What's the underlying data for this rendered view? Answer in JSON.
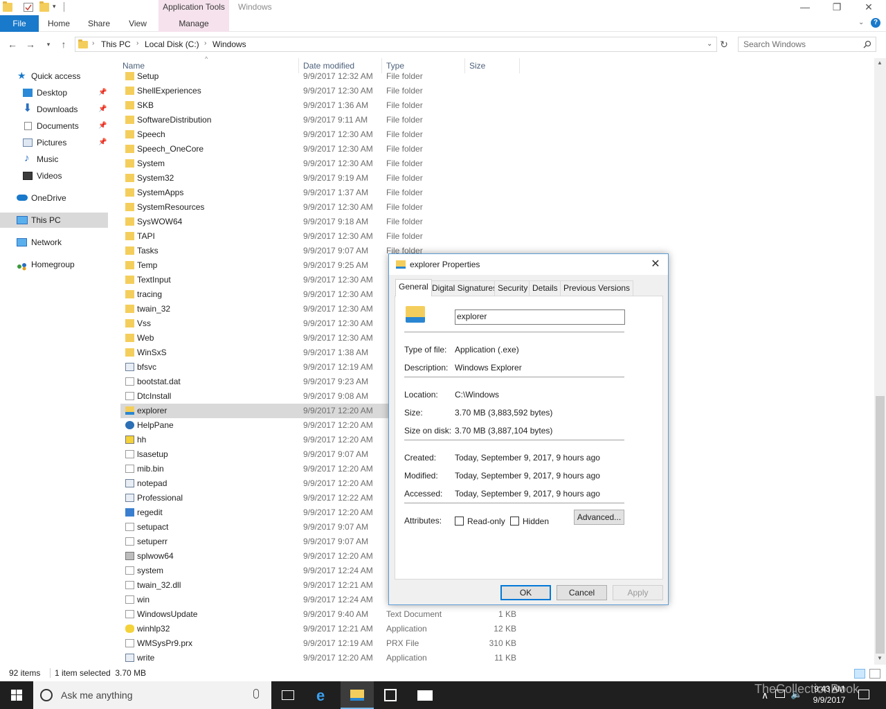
{
  "window": {
    "contextual_tab_group": "Application Tools",
    "title": "Windows",
    "minimize": "—",
    "maximize": "❐",
    "close": "✕"
  },
  "ribbon": {
    "file": "File",
    "tabs": [
      "Home",
      "Share",
      "View",
      "Manage"
    ]
  },
  "address": {
    "crumbs": [
      "This PC",
      "Local Disk (C:)",
      "Windows"
    ],
    "search_placeholder": "Search Windows"
  },
  "navpane": {
    "items": [
      {
        "label": "Quick access",
        "icon": "star-icon"
      },
      {
        "label": "Desktop",
        "icon": "desktop-icon",
        "pinned": true
      },
      {
        "label": "Downloads",
        "icon": "download-icon",
        "pinned": true
      },
      {
        "label": "Documents",
        "icon": "documents-icon",
        "pinned": true
      },
      {
        "label": "Pictures",
        "icon": "pictures-icon",
        "pinned": true
      },
      {
        "label": "Music",
        "icon": "music-icon"
      },
      {
        "label": "Videos",
        "icon": "videos-icon"
      },
      {
        "label": "OneDrive",
        "icon": "onedrive-icon"
      },
      {
        "label": "This PC",
        "icon": "computer-icon",
        "selected": true
      },
      {
        "label": "Network",
        "icon": "network-icon"
      },
      {
        "label": "Homegroup",
        "icon": "homegroup-icon"
      }
    ]
  },
  "columns": {
    "name": "Name",
    "date": "Date modified",
    "type": "Type",
    "size": "Size"
  },
  "files": [
    {
      "name": "Setup",
      "date": "9/9/2017 12:32 AM",
      "type": "File folder",
      "size": "",
      "icon": "folder"
    },
    {
      "name": "ShellExperiences",
      "date": "9/9/2017 12:30 AM",
      "type": "File folder",
      "size": "",
      "icon": "folder"
    },
    {
      "name": "SKB",
      "date": "9/9/2017 1:36 AM",
      "type": "File folder",
      "size": "",
      "icon": "folder"
    },
    {
      "name": "SoftwareDistribution",
      "date": "9/9/2017 9:11 AM",
      "type": "File folder",
      "size": "",
      "icon": "folder"
    },
    {
      "name": "Speech",
      "date": "9/9/2017 12:30 AM",
      "type": "File folder",
      "size": "",
      "icon": "folder"
    },
    {
      "name": "Speech_OneCore",
      "date": "9/9/2017 12:30 AM",
      "type": "File folder",
      "size": "",
      "icon": "folder"
    },
    {
      "name": "System",
      "date": "9/9/2017 12:30 AM",
      "type": "File folder",
      "size": "",
      "icon": "folder"
    },
    {
      "name": "System32",
      "date": "9/9/2017 9:19 AM",
      "type": "File folder",
      "size": "",
      "icon": "folder"
    },
    {
      "name": "SystemApps",
      "date": "9/9/2017 1:37 AM",
      "type": "File folder",
      "size": "",
      "icon": "folder"
    },
    {
      "name": "SystemResources",
      "date": "9/9/2017 12:30 AM",
      "type": "File folder",
      "size": "",
      "icon": "folder"
    },
    {
      "name": "SysWOW64",
      "date": "9/9/2017 9:18 AM",
      "type": "File folder",
      "size": "",
      "icon": "folder"
    },
    {
      "name": "TAPI",
      "date": "9/9/2017 12:30 AM",
      "type": "File folder",
      "size": "",
      "icon": "folder"
    },
    {
      "name": "Tasks",
      "date": "9/9/2017 9:07 AM",
      "type": "File folder",
      "size": "",
      "icon": "folder"
    },
    {
      "name": "Temp",
      "date": "9/9/2017 9:25 AM",
      "type": "",
      "size": "",
      "icon": "folder"
    },
    {
      "name": "TextInput",
      "date": "9/9/2017 12:30 AM",
      "type": "",
      "size": "",
      "icon": "folder"
    },
    {
      "name": "tracing",
      "date": "9/9/2017 12:30 AM",
      "type": "",
      "size": "",
      "icon": "folder"
    },
    {
      "name": "twain_32",
      "date": "9/9/2017 12:30 AM",
      "type": "",
      "size": "",
      "icon": "folder"
    },
    {
      "name": "Vss",
      "date": "9/9/2017 12:30 AM",
      "type": "",
      "size": "",
      "icon": "folder"
    },
    {
      "name": "Web",
      "date": "9/9/2017 12:30 AM",
      "type": "",
      "size": "",
      "icon": "folder"
    },
    {
      "name": "WinSxS",
      "date": "9/9/2017 1:38 AM",
      "type": "",
      "size": "",
      "icon": "folder"
    },
    {
      "name": "bfsvc",
      "date": "9/9/2017 12:19 AM",
      "type": "",
      "size": "",
      "icon": "app"
    },
    {
      "name": "bootstat.dat",
      "date": "9/9/2017 9:23 AM",
      "type": "",
      "size": "",
      "icon": "doc"
    },
    {
      "name": "DtcInstall",
      "date": "9/9/2017 9:08 AM",
      "type": "",
      "size": "",
      "icon": "doc"
    },
    {
      "name": "explorer",
      "date": "9/9/2017 12:20 AM",
      "type": "",
      "size": "",
      "icon": "explorer",
      "selected": true
    },
    {
      "name": "HelpPane",
      "date": "9/9/2017 12:20 AM",
      "type": "",
      "size": "",
      "icon": "help"
    },
    {
      "name": "hh",
      "date": "9/9/2017 12:20 AM",
      "type": "",
      "size": "",
      "icon": "hh"
    },
    {
      "name": "lsasetup",
      "date": "9/9/2017 9:07 AM",
      "type": "",
      "size": "",
      "icon": "doc"
    },
    {
      "name": "mib.bin",
      "date": "9/9/2017 12:20 AM",
      "type": "",
      "size": "",
      "icon": "doc"
    },
    {
      "name": "notepad",
      "date": "9/9/2017 12:20 AM",
      "type": "",
      "size": "",
      "icon": "app"
    },
    {
      "name": "Professional",
      "date": "9/9/2017 12:22 AM",
      "type": "",
      "size": "",
      "icon": "app"
    },
    {
      "name": "regedit",
      "date": "9/9/2017 12:20 AM",
      "type": "",
      "size": "",
      "icon": "reg"
    },
    {
      "name": "setupact",
      "date": "9/9/2017 9:07 AM",
      "type": "",
      "size": "",
      "icon": "doc"
    },
    {
      "name": "setuperr",
      "date": "9/9/2017 9:07 AM",
      "type": "",
      "size": "",
      "icon": "doc"
    },
    {
      "name": "splwow64",
      "date": "9/9/2017 12:20 AM",
      "type": "",
      "size": "",
      "icon": "print"
    },
    {
      "name": "system",
      "date": "9/9/2017 12:24 AM",
      "type": "",
      "size": "",
      "icon": "doc"
    },
    {
      "name": "twain_32.dll",
      "date": "9/9/2017 12:21 AM",
      "type": "",
      "size": "",
      "icon": "doc"
    },
    {
      "name": "win",
      "date": "9/9/2017 12:24 AM",
      "type": "",
      "size": "",
      "icon": "doc"
    },
    {
      "name": "WindowsUpdate",
      "date": "9/9/2017 9:40 AM",
      "type": "Text Document",
      "size": "1 KB",
      "icon": "doc"
    },
    {
      "name": "winhlp32",
      "date": "9/9/2017 12:21 AM",
      "type": "Application",
      "size": "12 KB",
      "icon": "wh"
    },
    {
      "name": "WMSysPr9.prx",
      "date": "9/9/2017 12:19 AM",
      "type": "PRX File",
      "size": "310 KB",
      "icon": "doc"
    },
    {
      "name": "write",
      "date": "9/9/2017 12:20 AM",
      "type": "Application",
      "size": "11 KB",
      "icon": "app"
    }
  ],
  "status": {
    "items": "92 items",
    "selected": "1 item selected  3.70 MB"
  },
  "dialog": {
    "title": "explorer Properties",
    "tabs": [
      "General",
      "Digital Signatures",
      "Security",
      "Details",
      "Previous Versions"
    ],
    "name_value": "explorer",
    "labels": {
      "type": "Type of file:",
      "description": "Description:",
      "location": "Location:",
      "size": "Size:",
      "size_on_disk": "Size on disk:",
      "created": "Created:",
      "modified": "Modified:",
      "accessed": "Accessed:",
      "attributes": "Attributes:"
    },
    "values": {
      "type": "Application (.exe)",
      "description": "Windows Explorer",
      "location": "C:\\Windows",
      "size": "3.70 MB (3,883,592 bytes)",
      "size_on_disk": "3.70 MB (3,887,104 bytes)",
      "created": "Today, September 9, 2017, 9 hours ago",
      "modified": "Today, September 9, 2017, 9 hours ago",
      "accessed": "Today, September 9, 2017, 9 hours ago"
    },
    "readonly": "Read-only",
    "hidden": "Hidden",
    "advanced": "Advanced...",
    "ok": "OK",
    "cancel": "Cancel",
    "apply": "Apply"
  },
  "taskbar": {
    "search_placeholder": "Ask me anything",
    "time": "9:43 AM",
    "date": "9/9/2017",
    "watermark": "TheCollectionBook"
  }
}
